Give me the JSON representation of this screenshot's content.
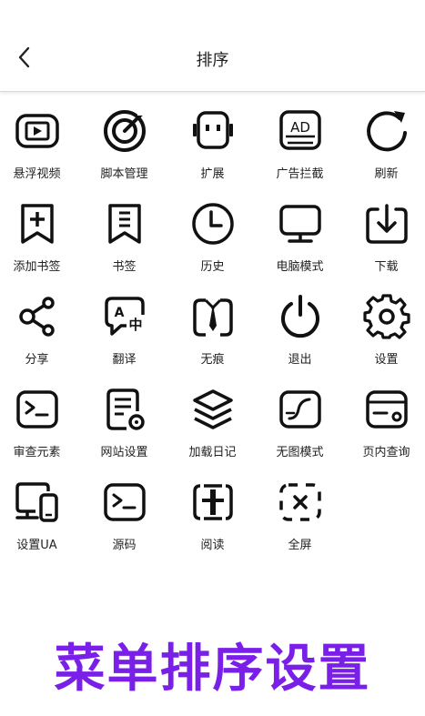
{
  "header": {
    "title": "排序"
  },
  "items": [
    {
      "label": "悬浮视频",
      "icon": "floating-video-icon"
    },
    {
      "label": "脚本管理",
      "icon": "script-manager-icon"
    },
    {
      "label": "扩展",
      "icon": "extension-icon"
    },
    {
      "label": "广告拦截",
      "icon": "ad-block-icon",
      "text": "AD"
    },
    {
      "label": "刷新",
      "icon": "refresh-icon"
    },
    {
      "label": "添加书签",
      "icon": "add-bookmark-icon"
    },
    {
      "label": "书签",
      "icon": "bookmarks-icon"
    },
    {
      "label": "历史",
      "icon": "history-icon"
    },
    {
      "label": "电脑模式",
      "icon": "desktop-mode-icon"
    },
    {
      "label": "下载",
      "icon": "download-icon"
    },
    {
      "label": "分享",
      "icon": "share-icon"
    },
    {
      "label": "翻译",
      "icon": "translate-icon"
    },
    {
      "label": "无痕",
      "icon": "incognito-icon"
    },
    {
      "label": "退出",
      "icon": "power-icon"
    },
    {
      "label": "设置",
      "icon": "settings-gear-icon"
    },
    {
      "label": "审查元素",
      "icon": "inspect-element-icon"
    },
    {
      "label": "网站设置",
      "icon": "site-settings-icon"
    },
    {
      "label": "加载日记",
      "icon": "load-log-icon"
    },
    {
      "label": "无图模式",
      "icon": "no-image-mode-icon"
    },
    {
      "label": "页内查询",
      "icon": "find-in-page-icon"
    },
    {
      "label": "设置UA",
      "icon": "user-agent-icon"
    },
    {
      "label": "源码",
      "icon": "source-code-icon"
    },
    {
      "label": "阅读",
      "icon": "reader-mode-icon"
    },
    {
      "label": "全屏",
      "icon": "fullscreen-icon"
    }
  ],
  "banner": {
    "text": "菜单排序设置"
  }
}
